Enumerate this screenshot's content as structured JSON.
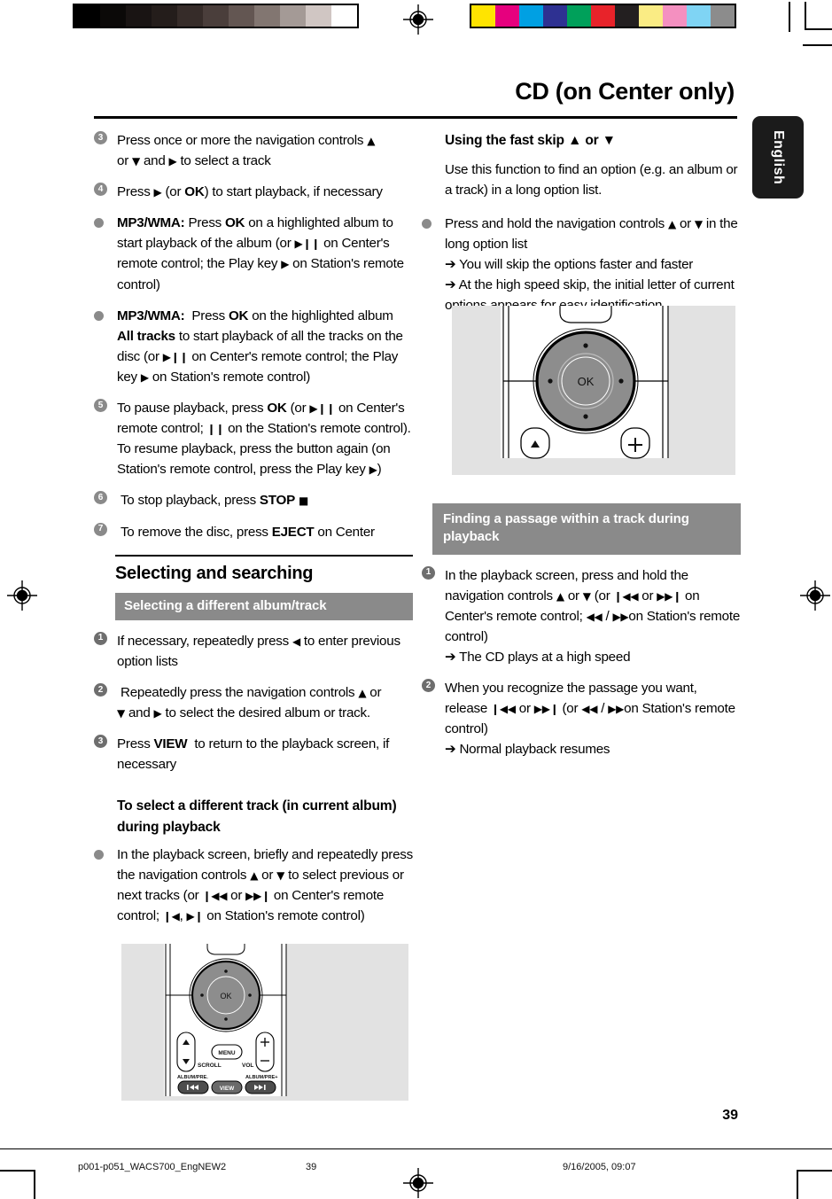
{
  "page": {
    "title": "CD (on Center only)",
    "language_tab": "English",
    "page_number": "39"
  },
  "calibration": {
    "grayscale_swatches": [
      "#000000",
      "#0b0908",
      "#191413",
      "#241d1b",
      "#362c29",
      "#4a3e3b",
      "#635652",
      "#827671",
      "#a49a96",
      "#d0c6c3",
      "#ffffff"
    ],
    "color_swatches": [
      "#ffe400",
      "#e6007e",
      "#00a0e3",
      "#2e3192",
      "#00a05a",
      "#e8232a",
      "#231f20",
      "#faec84",
      "#f490c0",
      "#7fd4f4",
      "#8c8c8c"
    ],
    "registration_icon": "registration-target-icon"
  },
  "left_column": {
    "steps": [
      {
        "marker": "3",
        "marker_type": "number",
        "html": "Press once or more the navigation controls <span class=\"glyph\">▲</span><br> or <span class=\"glyph\">▼</span> and <span class=\"glyph\">▶</span> to select a track"
      },
      {
        "marker": "4",
        "marker_type": "number",
        "html": "Press <span class=\"glyph\">▶</span> (or <b>OK</b>) to start playback, if necessary"
      },
      {
        "marker": "●",
        "marker_type": "bullet",
        "html": "<b>MP3/WMA:</b> Press <b>OK</b> on a highlighted album to start playback of the album (or <span class=\"glyph\">▶</span><b class=\"glyph\">❙❙</b> on Center's remote control; the Play key <span class=\"glyph\">▶</span> on Station's remote control)"
      },
      {
        "marker": "●",
        "marker_type": "bullet",
        "html": "<b>MP3/WMA:</b>&nbsp; Press <b>OK</b> on the highlighted album <b>All tracks</b> to start playback of all the tracks on the disc (or <span class=\"glyph\">▶</span><b class=\"glyph\">❙❙</b> on Center's remote control; the Play key <span class=\"glyph\">▶</span> on Station's remote control)"
      },
      {
        "marker": "5",
        "marker_type": "number",
        "html": "To pause playback, press <b>OK</b> (or <span class=\"glyph\">▶</span><b class=\"glyph\">❙❙</b> on Center's remote control; <b class=\"glyph\">❙❙</b> on the Station's remote control). To resume playback, press the button again (on Station's remote control, press the Play key <span class=\"glyph\">▶</span>)"
      },
      {
        "marker": "6",
        "marker_type": "number",
        "html": "&nbsp;To stop playback, press <b>STOP</b> <span class=\"glyph\">■</span>"
      },
      {
        "marker": "7",
        "marker_type": "number",
        "html": "&nbsp;To remove the disc, press <b>EJECT</b> on Center"
      }
    ],
    "section_title": "Selecting and searching",
    "subsection_bar": "Selecting a different album/track",
    "select_steps": [
      {
        "marker": "1",
        "marker_type": "number",
        "html": "If necessary, repeatedly press <span class=\"glyph\">◀</span> to enter previous option lists"
      },
      {
        "marker": "2",
        "marker_type": "number",
        "html": "&nbsp;Repeatedly press the navigation controls <span class=\"glyph\">▲</span> or<br> <span class=\"glyph\">▼</span> and <span class=\"glyph\">▶</span> to select the desired album or track."
      },
      {
        "marker": "3",
        "marker_type": "number",
        "html": "Press <b>VIEW</b> &nbsp;to return to the playback screen, if necessary"
      }
    ],
    "track_subhead": "To select a different track (in current album) during playback",
    "track_bullet": {
      "marker": "●",
      "marker_type": "bullet",
      "html": "In the playback screen, briefly and repeatedly press the navigation controls <span class=\"glyph\">▲</span> or <span class=\"glyph\">▼</span> to select previous or next tracks (or <span class=\"glyph\">❙◀◀</span> or <span class=\"glyph\">▶▶❙</span> on Center's remote control; <span class=\"glyph\">❙◀</span>, <span class=\"glyph\">▶❙</span> on Station's remote control)"
    }
  },
  "right_column": {
    "fast_skip_heading": "Using the fast skip ▲ or  ▼",
    "fast_skip_intro": "Use this function to find an option (e.g. an album or a track) in a long option list.",
    "fast_skip_bullet": {
      "marker": "●",
      "marker_type": "bullet",
      "html": "Press and hold the navigation controls <span class=\"glyph\">▲</span> or <span class=\"glyph\">▼</span> in the long option list<span class=\"arrowhint\"><span class=\"ar\">➔</span> You will skip the options faster and faster</span><span class=\"arrowhint\"><span class=\"ar\">➔</span> At the high speed skip, the initial letter of current options appears for easy identification</span>"
    },
    "passage_bar": "Finding a passage within a track during playback",
    "passage_steps": [
      {
        "marker": "1",
        "marker_type": "number",
        "html": "In the playback screen, press and hold the navigation controls <span class=\"glyph\">▲</span> or <span class=\"glyph\">▼</span> (or <span class=\"glyph\">❙◀◀</span> or <span class=\"glyph\">▶▶❙</span> on Center's remote control; <span class=\"glyph\">◀◀</span> / <span class=\"glyph\">▶▶</span>on Station's remote control)<span class=\"arrowhint\"><span class=\"ar\">➔</span> The CD plays at a high speed</span>"
      },
      {
        "marker": "2",
        "marker_type": "number",
        "html": "When you recognize the passage you want, release <span class=\"glyph\">❙◀◀</span> or <span class=\"glyph\">▶▶❙</span> (or <span class=\"glyph\">◀◀</span> / <span class=\"glyph\">▶▶</span>on Station's remote control)<span class=\"arrowhint\"><span class=\"ar\">➔</span> Normal playback resumes</span>"
      }
    ]
  },
  "figures": {
    "remote_center": {
      "name": "center-remote-navigation-detail",
      "ok_label": "OK",
      "eject_label": "▲",
      "plus_label": "+"
    },
    "remote_station": {
      "name": "station-remote-full-detail",
      "ok_label": "OK",
      "menu_label": "MENU",
      "view_label": "VIEW",
      "scroll_label": "SCROLL",
      "vol_label": "VOL",
      "album_minus_label": "ALBUM/PRE.",
      "album_plus_label": "ALBUM/PRE+",
      "plus_label": "+",
      "minus_label": "—"
    }
  },
  "footer": {
    "file": "p001-p051_WACS700_EngNEW2",
    "page": "39",
    "date": "9/16/2005, 09:07"
  }
}
